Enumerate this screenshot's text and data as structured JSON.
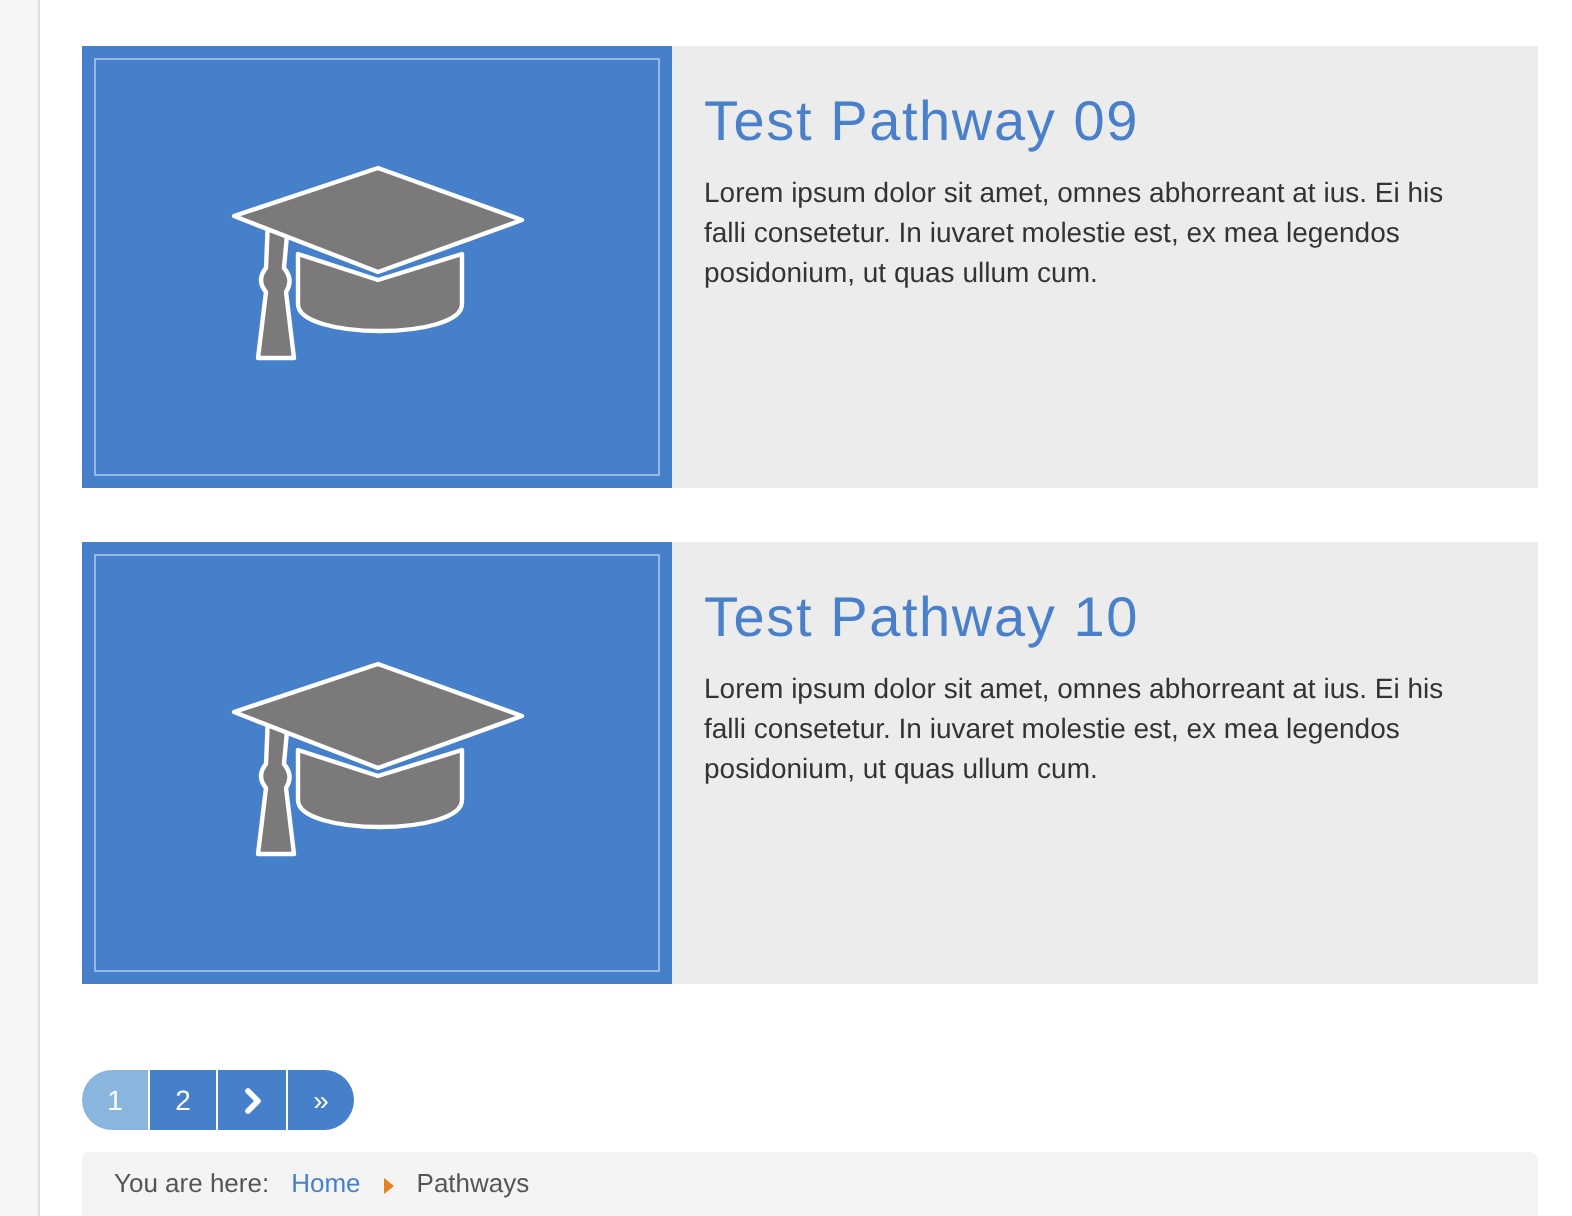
{
  "pathways": [
    {
      "title": "Test Pathway 09",
      "description": "Lorem ipsum dolor sit amet, omnes abhorreant at ius. Ei his falli consetetur. In iuvaret molestie est, ex mea legendos posidonium, ut quas ullum cum."
    },
    {
      "title": "Test Pathway 10",
      "description": "Lorem ipsum dolor sit amet, omnes abhorreant at ius. Ei his falli consetetur. In iuvaret molestie est, ex mea legendos posidonium, ut quas ullum cum."
    }
  ],
  "pagination": [
    {
      "kind": "page",
      "label": "1",
      "selected": true
    },
    {
      "kind": "page",
      "label": "2",
      "selected": false
    },
    {
      "kind": "next"
    },
    {
      "kind": "last",
      "label": "»"
    }
  ],
  "breadcrumb": {
    "label": "You are here:",
    "items": [
      {
        "kind": "link",
        "label": "Home"
      },
      {
        "kind": "current",
        "label": "Pathways"
      }
    ]
  }
}
